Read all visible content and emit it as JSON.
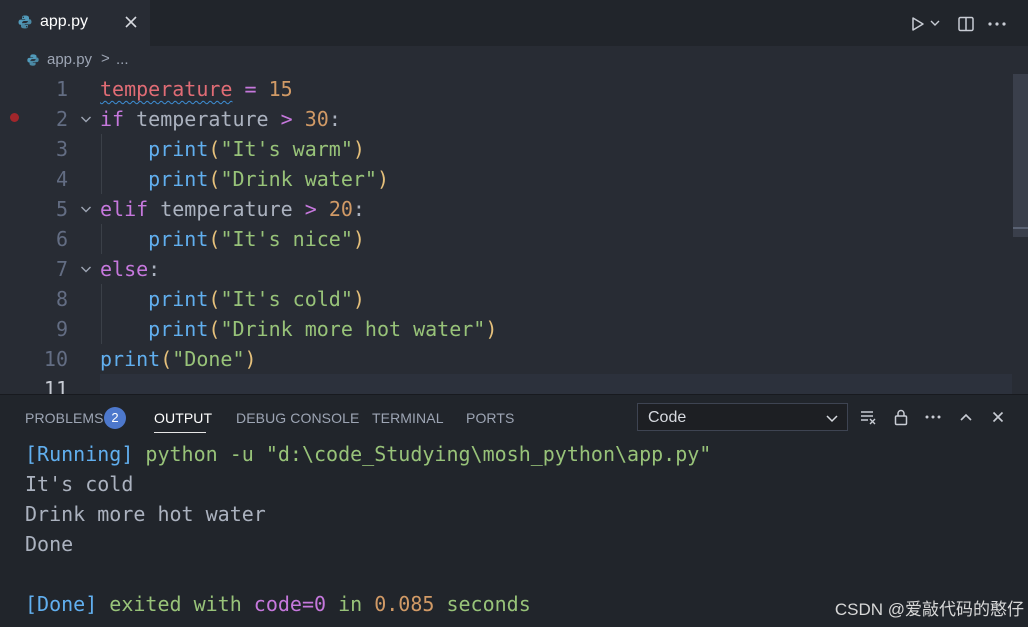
{
  "tab": {
    "filename": "app.py"
  },
  "breadcrumb": {
    "file": "app.py",
    "separator": ">",
    "ellipsis": "..."
  },
  "editor": {
    "lines": [
      {
        "n": "1",
        "tokens": [
          [
            "var squiggle",
            "temperature"
          ],
          [
            "txt",
            " "
          ],
          [
            "op",
            "="
          ],
          [
            "txt",
            " "
          ],
          [
            "num",
            "15"
          ]
        ]
      },
      {
        "n": "2",
        "tokens": [
          [
            "kw",
            "if"
          ],
          [
            "txt",
            " temperature "
          ],
          [
            "op",
            ">"
          ],
          [
            "txt",
            " "
          ],
          [
            "num",
            "30"
          ],
          [
            "txt",
            ":"
          ]
        ]
      },
      {
        "n": "3",
        "tokens": [
          [
            "txt",
            "    "
          ],
          [
            "fn",
            "print"
          ],
          [
            "p1",
            "("
          ],
          [
            "str",
            "\"It's warm\""
          ],
          [
            "p1",
            ")"
          ]
        ]
      },
      {
        "n": "4",
        "tokens": [
          [
            "txt",
            "    "
          ],
          [
            "fn",
            "print"
          ],
          [
            "p1",
            "("
          ],
          [
            "str",
            "\"Drink water\""
          ],
          [
            "p1",
            ")"
          ]
        ]
      },
      {
        "n": "5",
        "tokens": [
          [
            "kw",
            "elif"
          ],
          [
            "txt",
            " temperature "
          ],
          [
            "op",
            ">"
          ],
          [
            "txt",
            " "
          ],
          [
            "num",
            "20"
          ],
          [
            "txt",
            ":"
          ]
        ]
      },
      {
        "n": "6",
        "tokens": [
          [
            "txt",
            "    "
          ],
          [
            "fn",
            "print"
          ],
          [
            "p1",
            "("
          ],
          [
            "str",
            "\"It's nice\""
          ],
          [
            "p1",
            ")"
          ]
        ]
      },
      {
        "n": "7",
        "tokens": [
          [
            "kw",
            "else"
          ],
          [
            "txt",
            ":"
          ]
        ]
      },
      {
        "n": "8",
        "tokens": [
          [
            "txt",
            "    "
          ],
          [
            "fn",
            "print"
          ],
          [
            "p1",
            "("
          ],
          [
            "str",
            "\"It's cold\""
          ],
          [
            "p1",
            ")"
          ]
        ]
      },
      {
        "n": "9",
        "tokens": [
          [
            "txt",
            "    "
          ],
          [
            "fn",
            "print"
          ],
          [
            "p1",
            "("
          ],
          [
            "str",
            "\"Drink more hot water\""
          ],
          [
            "p1",
            ")"
          ]
        ]
      },
      {
        "n": "10",
        "tokens": [
          [
            "fn",
            "print"
          ],
          [
            "p1",
            "("
          ],
          [
            "str",
            "\"Done\""
          ],
          [
            "p1",
            ")"
          ]
        ]
      },
      {
        "n": "11",
        "tokens": []
      }
    ],
    "breakpoint_line": "2",
    "fold_lines": [
      "2",
      "5",
      "7"
    ]
  },
  "panel": {
    "tabs": [
      "PROBLEMS",
      "OUTPUT",
      "DEBUG CONSOLE",
      "TERMINAL",
      "PORTS"
    ],
    "active_tab": "OUTPUT",
    "problems_count": "2",
    "output_channel": "Code",
    "output": {
      "running_tag": "[Running]",
      "command": " python -u \"d:\\code_Studying\\mosh_python\\app.py\"",
      "lines": [
        "It's cold",
        "Drink more hot water",
        "Done"
      ],
      "done_tag": "[Done]",
      "exited_with": " exited with ",
      "code_label": "code=0",
      "in_label": " in ",
      "duration": "0.085",
      "seconds_label": " seconds"
    }
  },
  "watermark": "CSDN @爱敲代码的憨仔",
  "colors": {
    "accent": "#4d78cc",
    "breakpoint": "#a1262b"
  }
}
